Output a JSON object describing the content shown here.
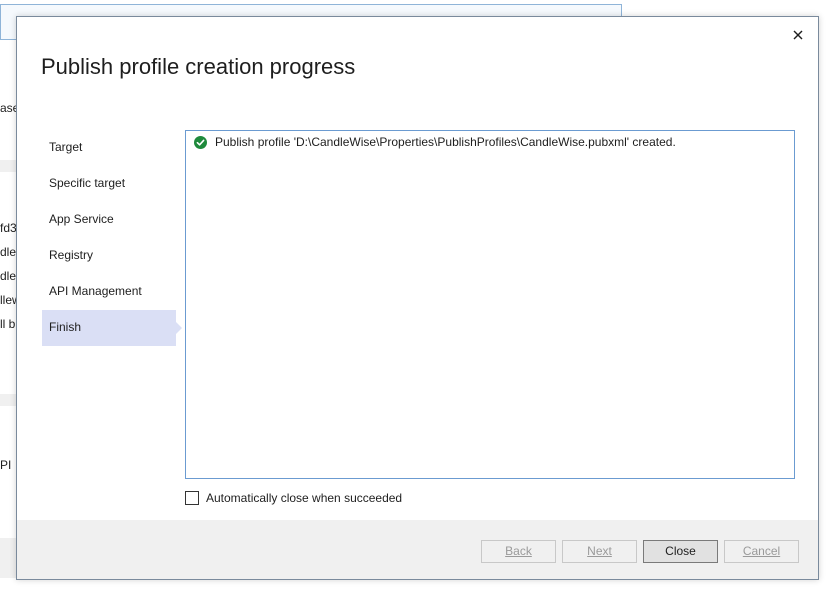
{
  "background": {
    "fragments": [
      "ase",
      "fd3",
      "dleV",
      "dleV",
      "llew",
      "ll b",
      "PI"
    ]
  },
  "dialog": {
    "title": "Publish profile creation progress",
    "close_icon": "close-icon",
    "steps": [
      {
        "label": "Target",
        "active": false
      },
      {
        "label": "Specific target",
        "active": false
      },
      {
        "label": "App Service",
        "active": false
      },
      {
        "label": "Registry",
        "active": false
      },
      {
        "label": "API Management",
        "active": false
      },
      {
        "label": "Finish",
        "active": true
      }
    ],
    "log": {
      "status_icon": "check-circle-icon",
      "message": "Publish profile 'D:\\CandleWise\\Properties\\PublishProfiles\\CandleWise.pubxml' created."
    },
    "auto_close": {
      "label": "Automatically close when succeeded",
      "checked": false
    },
    "buttons": {
      "back": "Back",
      "next": "Next",
      "close": "Close",
      "cancel": "Cancel"
    }
  },
  "colors": {
    "active_step": "#dadff5",
    "success_green": "#1e8a3c",
    "panel_border": "#6b9bd1",
    "footer_bg": "#f0f0f0"
  }
}
